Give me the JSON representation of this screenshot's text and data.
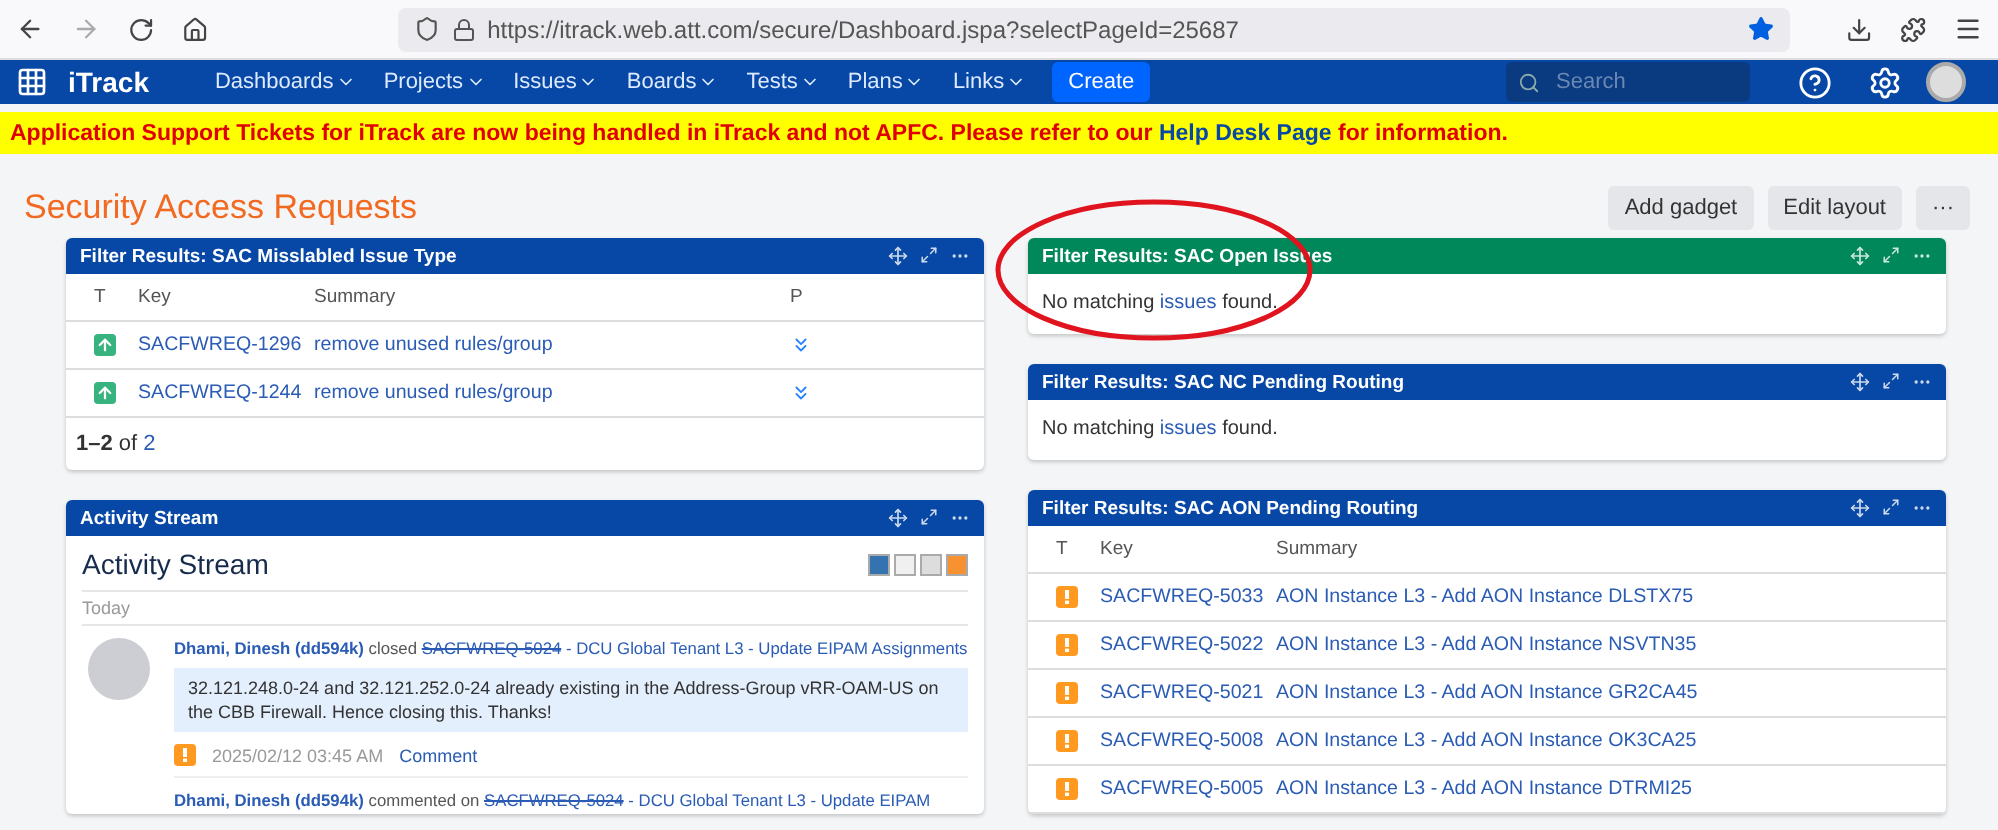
{
  "browser": {
    "url": "https://itrack.web.att.com/secure/Dashboard.jspa?selectPageId=25687"
  },
  "nav": {
    "logo": "iTrack",
    "menus": [
      "Dashboards",
      "Projects",
      "Issues",
      "Boards",
      "Tests",
      "Plans",
      "Links"
    ],
    "create": "Create",
    "search_placeholder": "Search"
  },
  "banner": {
    "before": "Application Support Tickets for iTrack are now being handled in iTrack and not APFC. Please refer to our",
    "link": "Help Desk Page",
    "after": "for information."
  },
  "page": {
    "title": "Security Access Requests",
    "actions": [
      "Add gadget",
      "Edit layout",
      "···"
    ]
  },
  "left": [
    {
      "kind": "table",
      "title": "Filter Results: SAC Misslabled Issue Type",
      "color": "#0747a6",
      "circled": false,
      "columns": [
        "T",
        "Key",
        "Summary",
        "P"
      ],
      "rows": [
        {
          "kind": "improvement",
          "key": "SACFWREQ-1296",
          "summary": "remove unused rules/group",
          "priority": {
            "kind": "lowest"
          }
        },
        {
          "kind": "improvement",
          "key": "SACFWREQ-1244",
          "summary": "remove unused rules/group",
          "priority": {
            "kind": "lowest"
          }
        }
      ],
      "footer": {
        "range": "**1–2** of",
        "total": "2"
      }
    },
    {
      "kind": "activity",
      "title": "Activity Stream",
      "color": "#0747a6",
      "circled": false,
      "heading": "Activity Stream",
      "group": "Today",
      "entries": [
        {
          "user": "Dhami, Dinesh (dd594k)",
          "action": "closed",
          "issue_key": "SACFWREQ-5024",
          "issue_title": "- DCU Global Tenant L3 - Update EIPAM Assignments",
          "comment": "32.121.248.0-24 and 32.121.252.0-24 already existing in the Address-Group vRR-OAM-US on the CBB Firewall. Hence closing this. Thanks!",
          "time": "2025/02/12 03:45 AM",
          "link": "Comment"
        },
        {
          "user": "Dhami, Dinesh (dd594k)",
          "action": "commented on",
          "issue_key": "SACFWREQ-5024",
          "issue_title": "- DCU Global Tenant L3 - Update EIPAM"
        }
      ]
    }
  ],
  "right": [
    {
      "kind": "empty",
      "title": "Filter Results: SAC Open Issues",
      "color": "#00875a",
      "circled": true,
      "before": "No matching",
      "link": "issues",
      "after": "found."
    },
    {
      "kind": "empty",
      "title": "Filter Results: SAC NC Pending Routing",
      "color": "#0747a6",
      "circled": false,
      "before": "No matching",
      "link": "issues",
      "after": "found."
    },
    {
      "kind": "table",
      "title": "Filter Results: SAC AON Pending Routing",
      "color": "#0747a6",
      "circled": false,
      "columns": [
        "T",
        "Key",
        "Summary"
      ],
      "rows": [
        {
          "kind": "alert",
          "key": "SACFWREQ-5033",
          "summary": "AON Instance L3 - Add AON Instance DLSTX75"
        },
        {
          "kind": "alert",
          "key": "SACFWREQ-5022",
          "summary": "AON Instance L3 - Add AON Instance NSVTN35"
        },
        {
          "kind": "alert",
          "key": "SACFWREQ-5021",
          "summary": "AON Instance L3 - Add AON Instance GR2CA45"
        },
        {
          "kind": "alert",
          "key": "SACFWREQ-5008",
          "summary": "AON Instance L3 - Add AON Instance OK3CA25"
        },
        {
          "kind": "alert",
          "key": "SACFWREQ-5005",
          "summary": "AON Instance L3 - Add AON Instance DTRMI25"
        }
      ]
    }
  ]
}
